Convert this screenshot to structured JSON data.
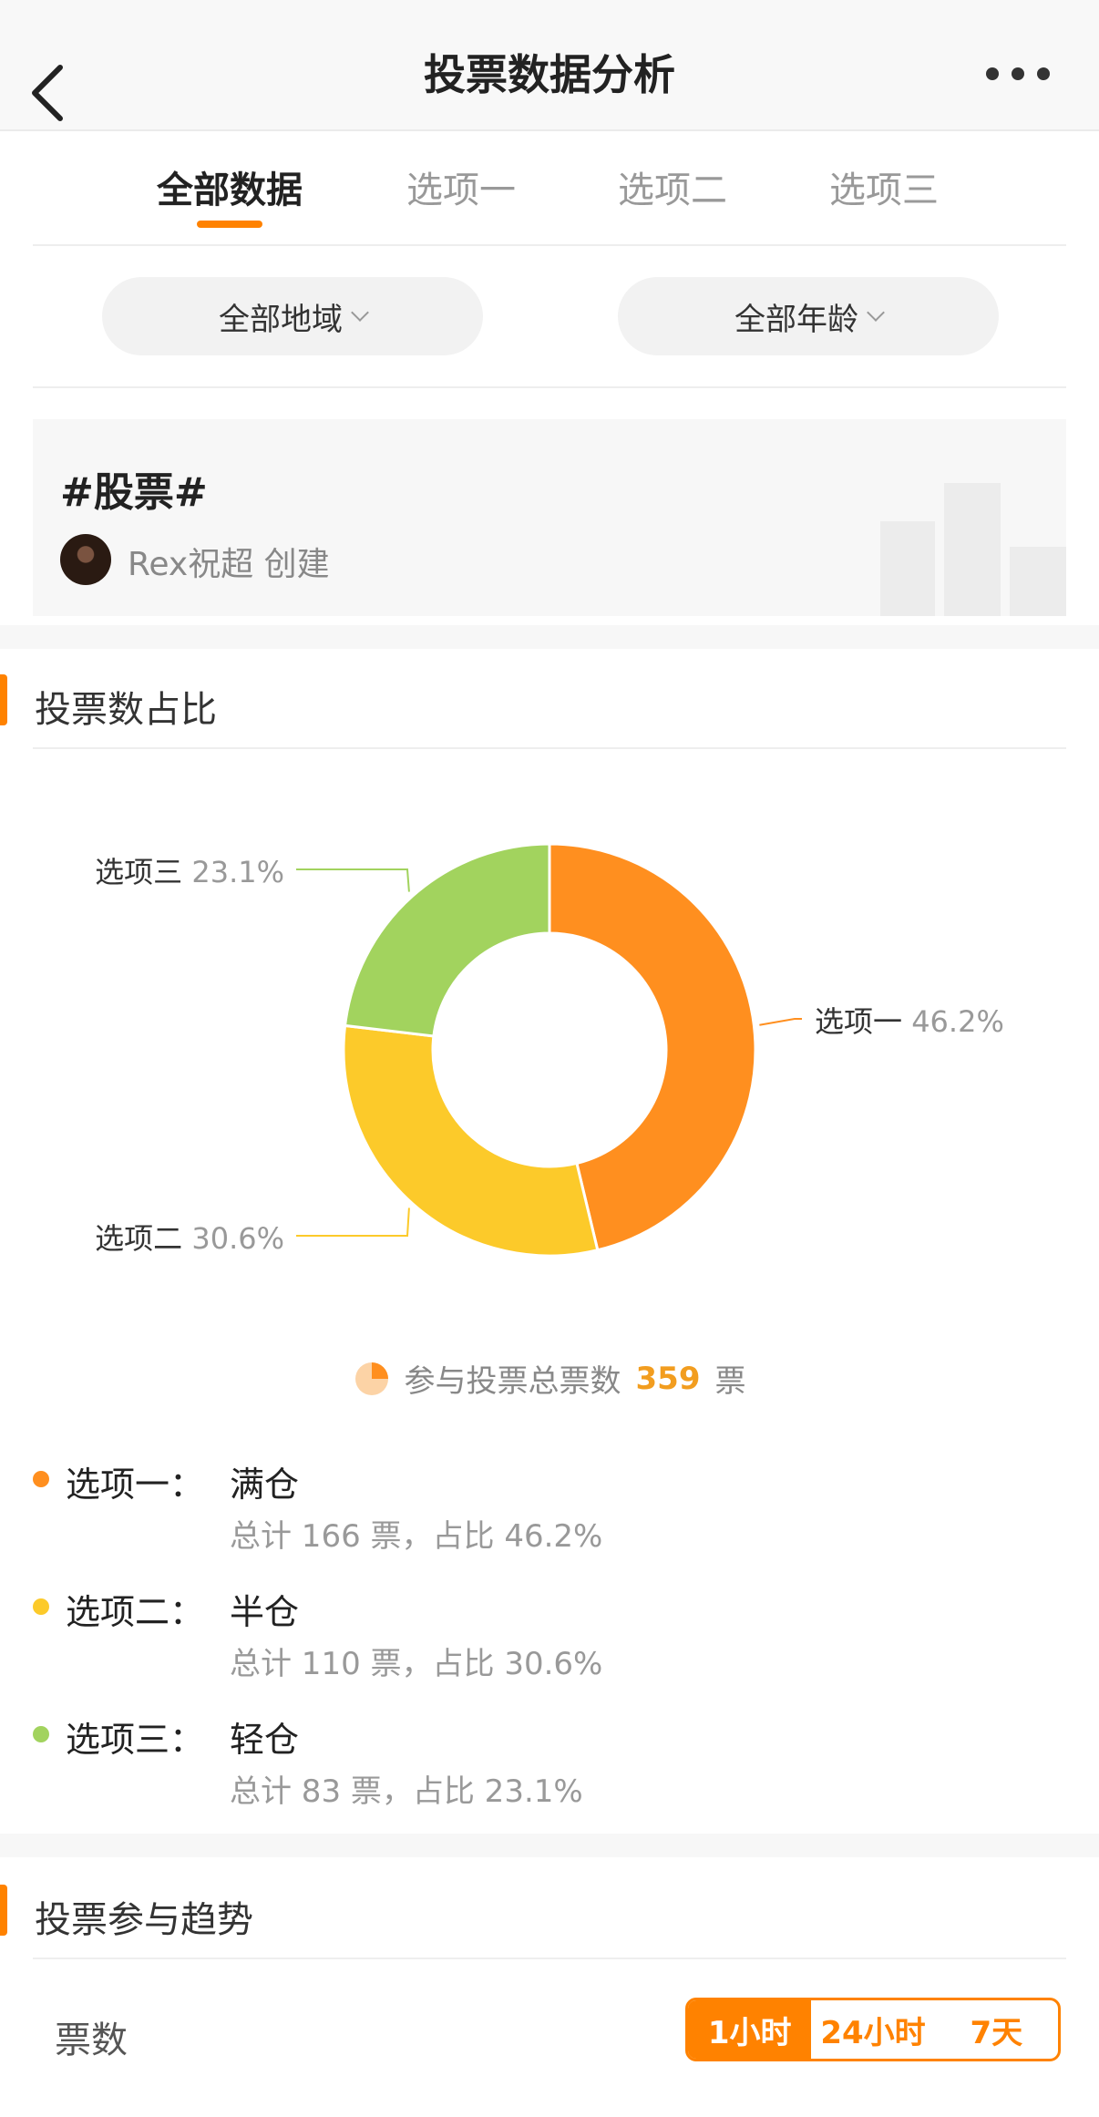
{
  "header": {
    "title": "投票数据分析"
  },
  "tabs": [
    {
      "label": "全部数据",
      "active": true
    },
    {
      "label": "选项一"
    },
    {
      "label": "选项二"
    },
    {
      "label": "选项三"
    }
  ],
  "filters": {
    "region": "全部地域",
    "age": "全部年龄"
  },
  "topic": {
    "title": "#股票#",
    "creator": "Rex祝超 创建"
  },
  "section1": {
    "title": "投票数占比"
  },
  "colors": {
    "accent": "#ff8200",
    "option1": "#ff8f1f",
    "option2": "#fcca2a",
    "option3": "#a2d35e"
  },
  "chart_data": {
    "type": "pie",
    "categories": [
      "选项一",
      "选项二",
      "选项三"
    ],
    "values": [
      46.2,
      30.6,
      23.1
    ],
    "labels": [
      "选项一",
      "选项二",
      "选项三"
    ],
    "percent_labels": [
      "46.2%",
      "30.6%",
      "23.1%"
    ]
  },
  "total": {
    "prefix": "参与投票总票数",
    "count": "359",
    "suffix": "票"
  },
  "options": [
    {
      "label": "选项一：",
      "name": "满仓",
      "detail": "总计 166 票，占比 46.2%"
    },
    {
      "label": "选项二：",
      "name": "半仓",
      "detail": "总计 110 票，占比 30.6%"
    },
    {
      "label": "选项三：",
      "name": "轻仓",
      "detail": "总计 83 票，占比 23.1%"
    }
  ],
  "section2": {
    "title": "投票参与趋势"
  },
  "trend": {
    "unit_label": "票数",
    "ranges": [
      {
        "label": "1小时",
        "active": true
      },
      {
        "label": "24小时"
      },
      {
        "label": "7天"
      }
    ]
  }
}
